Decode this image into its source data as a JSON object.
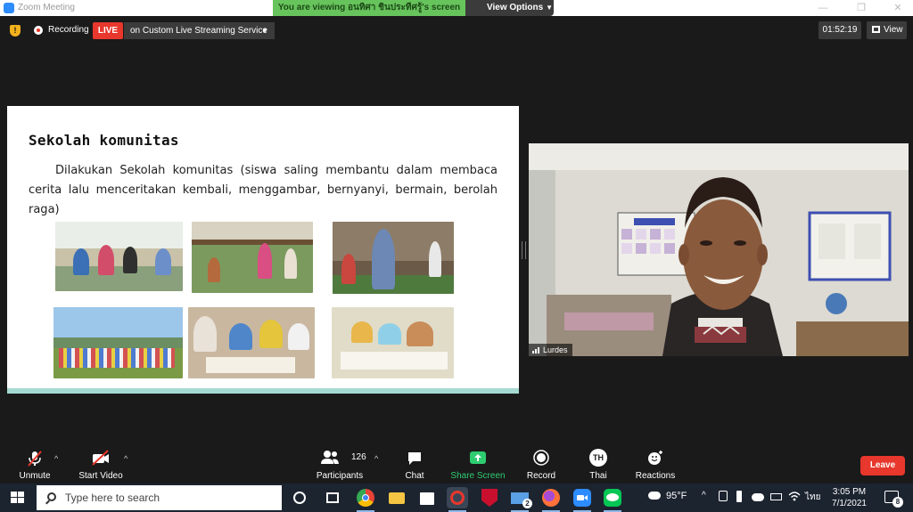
{
  "window": {
    "title": "Zoom Meeting",
    "viewing_banner": "You are viewing อนทิศา ชินประทีศรู้'s screen",
    "view_options_label": "View Options"
  },
  "top_bar": {
    "recording_label": "Recording",
    "live_badge": "LIVE",
    "stream_label": "on Custom Live Streaming Service",
    "timer": "01:52:19",
    "view_label": "View"
  },
  "slide": {
    "title": "Sekolah komunitas",
    "body": "Dilakukan Sekolah komunitas (siswa saling membantu dalam membaca cerita lalu menceritakan kembali, menggambar, bernyanyi, bermain, berolah raga)",
    "photos": [
      {
        "name": "children-reading-photo"
      },
      {
        "name": "children-outdoor-class-photo"
      },
      {
        "name": "boy-singing-photo"
      },
      {
        "name": "group-field-photo"
      },
      {
        "name": "kids-reading-floor-photo"
      },
      {
        "name": "kids-drawing-floor-photo"
      }
    ]
  },
  "video": {
    "participant_name": "Lurdes"
  },
  "toolbar": {
    "unmute": "Unmute",
    "start_video": "Start Video",
    "participants_label": "Participants",
    "participants_count": "126",
    "chat": "Chat",
    "share_screen": "Share Screen",
    "record": "Record",
    "language_initials": "TH",
    "language": "Thai",
    "reactions": "Reactions",
    "leave": "Leave",
    "share_color": "#2ecc71"
  },
  "taskbar": {
    "search_placeholder": "Type here to search",
    "mail_badge": "2",
    "weather": "95°F",
    "input_lang": "ไทย",
    "time": "3:05 PM",
    "date": "7/1/2021",
    "notifications": "8"
  }
}
